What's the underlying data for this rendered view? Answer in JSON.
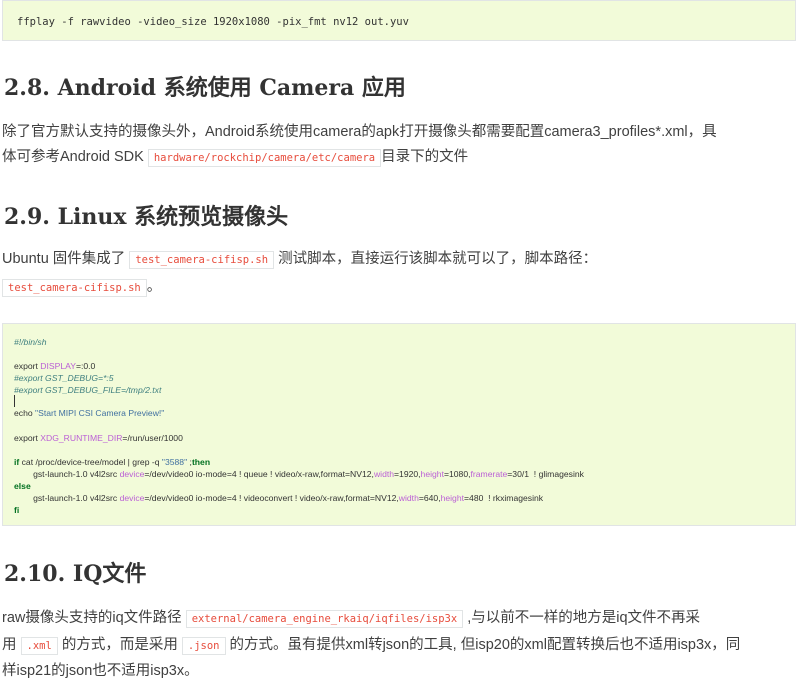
{
  "cmd_line": "ffplay -f rawvideo -video_size 1920x1080 -pix_fmt nv12 out.yuv",
  "sec_2_8": {
    "heading": "2.8. Android 系统使用 Camera 应用",
    "p1": "除了官方默认支持的摄像头外，Android系统使用camera的apk打开摄像头都需要配置camera3_profiles*.xml，具",
    "p2_pre": "体可参考Android SDK ",
    "p2_code": "hardware/rockchip/camera/etc/camera",
    "p2_post": "目录下的文件"
  },
  "sec_2_9": {
    "heading": "2.9. Linux 系统预览摄像头",
    "p1_pre": "Ubuntu 固件集成了 ",
    "p1_code": "test_camera-cifisp.sh",
    "p1_post": " 测试脚本，直接运行该脚本就可以了，脚本路径：",
    "p2_code": "test_camera-cifisp.sh",
    "p2_post": "。"
  },
  "script": {
    "shebang": "#!/bin/sh",
    "export_kw": "export ",
    "display_var": "DISPLAY",
    "display_val": "=:0.0",
    "debug_comment": "#export GST_DEBUG=*:5",
    "debug_file_comment": "#export GST_DEBUG_FILE=/tmp/2.txt",
    "echo_kw": "echo ",
    "echo_str": "\"Start MIPI CSI Camera Preview!\"",
    "export_kw2": "export ",
    "xdg_var": "XDG_RUNTIME_DIR",
    "xdg_val": "=/run/user/1000",
    "if_kw": "if",
    "if_rest": " cat /proc/device-tree/model | grep -q ",
    "if_str": "\"3588\"",
    "if_semi": " ;",
    "then_kw": "then",
    "line1_a": "        gst-launch-1.0 v4l2src ",
    "line1_dev": "device",
    "line1_b": "=/dev/video0 io-mode=4 ! queue ! video/x-raw,format=NV12,",
    "line1_w": "width",
    "line1_c": "=1920,",
    "line1_h": "height",
    "line1_d": "=1080,",
    "line1_f": "framerate",
    "line1_e": "=30/1  ! glimagesink",
    "else_kw": "else",
    "line2_a": "        gst-launch-1.0 v4l2src ",
    "line2_dev": "device",
    "line2_b": "=/dev/video0 io-mode=4 ! videoconvert ! video/x-raw,format=NV12,",
    "line2_w": "width",
    "line2_c": "=640,",
    "line2_h": "height",
    "line2_d": "=480  ! rkximagesink",
    "fi_kw": "fi"
  },
  "sec_2_10": {
    "heading": "2.10. IQ文件",
    "p1_pre": "raw摄像头支持的iq文件路径 ",
    "p1_code": "external/camera_engine_rkaiq/iqfiles/isp3x",
    "p1_post": " ,与以前不一样的地方是iq文件不再采",
    "p2_pre": "用 ",
    "p2_code1": ".xml",
    "p2_mid": " 的方式，而是采用 ",
    "p2_code2": ".json",
    "p2_post": " 的方式。虽有提供xml转json的工具, 但isp20的xml配置转换后也不适用isp3x，同",
    "p3": "样isp21的json也不适用isp3x。"
  }
}
